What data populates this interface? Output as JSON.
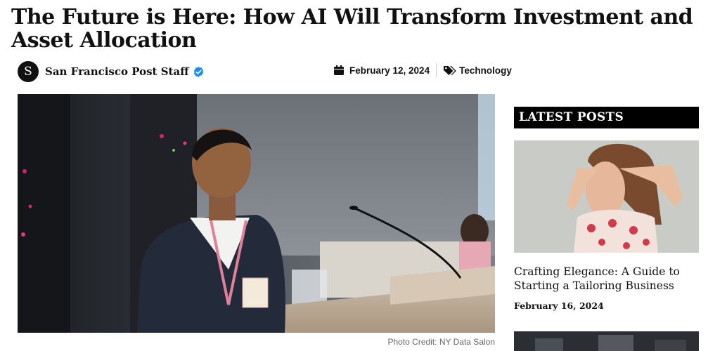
{
  "article": {
    "title": "The Future is Here: How AI Will Transform Investment and Asset Allocation",
    "author": {
      "name": "San Francisco Post Staff",
      "avatar_initial": "S",
      "verified_icon": "verified-check-icon"
    },
    "date": "February 12, 2024",
    "category": "Technology",
    "hero_image": {
      "description_icon": "speaker-at-podium-photo",
      "caption": "Photo Credit: NY Data Salon"
    }
  },
  "sidebar": {
    "heading": "LATEST POSTS",
    "posts": [
      {
        "title": "Crafting Elegance: A Guide to Starting a Tailoring Business",
        "date": "February 16, 2024"
      }
    ]
  },
  "colors": {
    "text": "#111111",
    "verified": "#1d8cf0",
    "heading_bg": "#000000",
    "caption": "#666666"
  }
}
